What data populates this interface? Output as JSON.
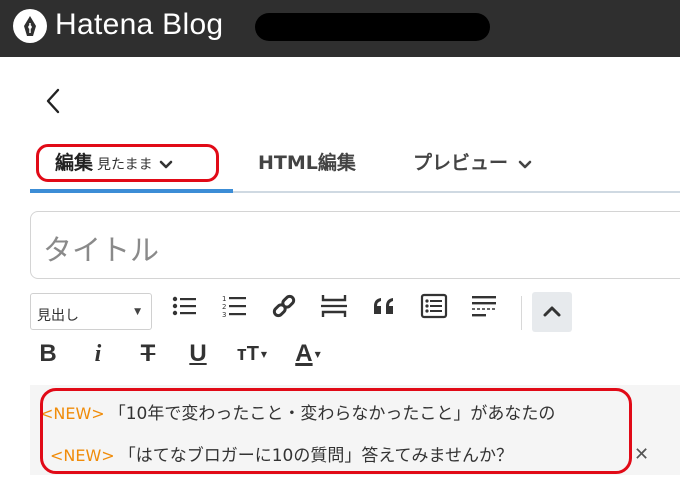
{
  "header": {
    "brand": "Hatena Blog",
    "logo_icon": "hatena-pen-icon",
    "redacted": true
  },
  "nav": {
    "back_icon": "chevron-left-icon"
  },
  "tabs": [
    {
      "label": "編集",
      "sub": "見たまま",
      "icon": "chevron-down-icon",
      "active": true
    },
    {
      "label": "HTML編集"
    },
    {
      "label": "プレビュー",
      "icon": "chevron-down-icon"
    }
  ],
  "title_input": {
    "placeholder": "タイトル"
  },
  "toolbar": {
    "heading_select": "見出し",
    "row1_icons": [
      "bulleted-list-icon",
      "numbered-list-icon",
      "link-icon",
      "page-break-icon",
      "quote-icon",
      "table-of-contents-icon",
      "read-more-icon"
    ],
    "collapse_icon": "chevron-up-icon",
    "row2": {
      "bold": "B",
      "italic": "i",
      "strike": "T",
      "underline": "U",
      "font_size": "тT",
      "font_color": "A"
    }
  },
  "notices": [
    {
      "tag": "<NEW>",
      "text": "「10年で変わったこと・変わらなかったこと」があなたの"
    },
    {
      "tag": "<NEW>",
      "text": "「はてなブロガーに10の質問」答えてみませんか？"
    }
  ],
  "colors": {
    "header_bg": "#2f2f2f",
    "accent_blue": "#3c8dd6",
    "new_orange": "#f08c0a",
    "annotation_red": "#e10a17"
  }
}
